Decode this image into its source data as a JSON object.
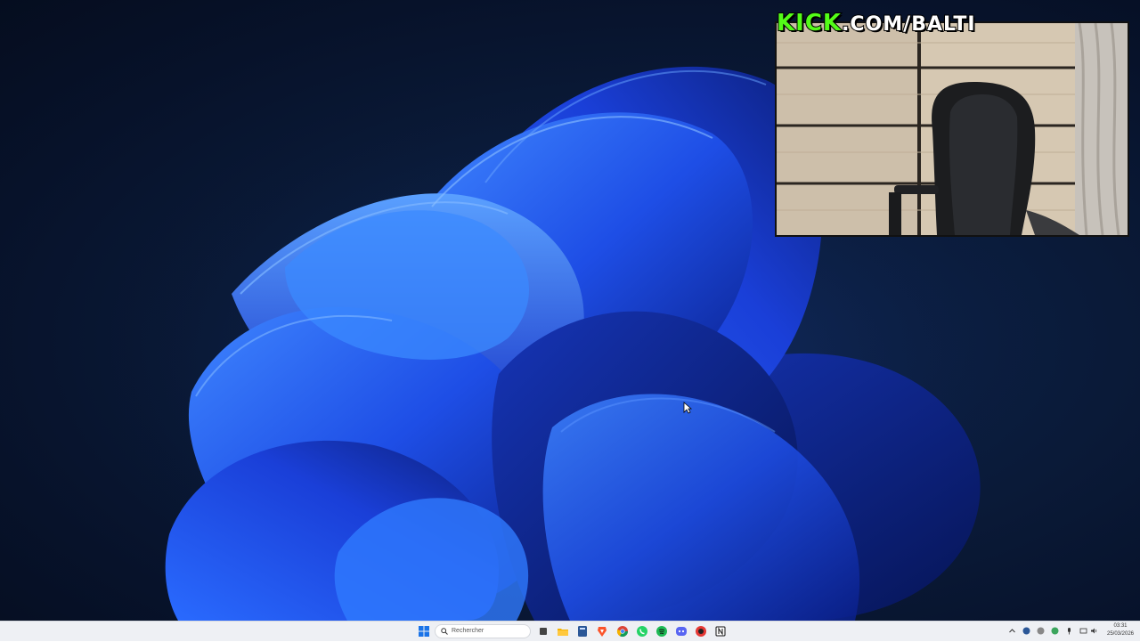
{
  "overlay": {
    "brand": "KICK",
    "path": ".COM/BALTI"
  },
  "taskbar": {
    "search_placeholder": "Rechercher",
    "pinned_apps": [
      "start-icon",
      "search-icon",
      "task-view-icon",
      "file-explorer-icon",
      "calculator-icon",
      "brave-browser-icon",
      "chrome-icon",
      "whatsapp-icon",
      "spotify-icon",
      "discord-icon",
      "app-icon",
      "notion-icon"
    ],
    "tray_icons": [
      "chevron-up-icon",
      "tray-app-icon",
      "tray-app-icon",
      "tray-app-icon",
      "microphone-icon",
      "network-icon",
      "volume-icon"
    ]
  },
  "clock": {
    "time": "03:31",
    "date": "25/03/2026"
  },
  "colors": {
    "kick_green": "#53fc18",
    "wallpaper_blue": "#1d4fe0",
    "taskbar_bg": "#eef0f4"
  }
}
